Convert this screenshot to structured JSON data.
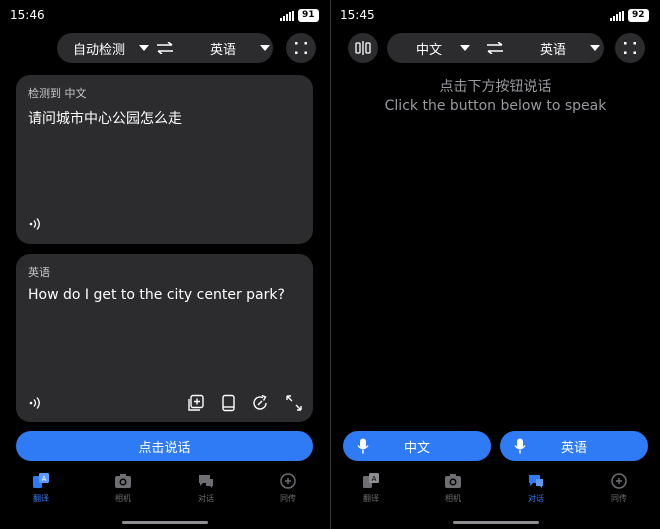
{
  "left": {
    "status": {
      "time": "15:46",
      "battery": "91"
    },
    "lang_bar": {
      "source": "自动检测",
      "target": "英语"
    },
    "source_card": {
      "label": "检测到 中文",
      "text": "请问城市中心公园怎么走"
    },
    "target_card": {
      "label": "英语",
      "text": "How do I get to the city center park?"
    },
    "speak_button": "点击说话"
  },
  "right": {
    "status": {
      "time": "15:45",
      "battery": "92"
    },
    "lang_bar": {
      "source": "中文",
      "target": "英语"
    },
    "hint_cn": "点击下方按钮说话",
    "hint_en": "Click the button below to speak",
    "mic_buttons": [
      "中文",
      "英语"
    ]
  },
  "nav": [
    {
      "label": "翻译",
      "icon": "translate-icon"
    },
    {
      "label": "相机",
      "icon": "camera-icon"
    },
    {
      "label": "对话",
      "icon": "chat-icon"
    },
    {
      "label": "同传",
      "icon": "simultaneous-icon"
    }
  ],
  "left_active_nav": "翻译",
  "right_active_nav": "对话",
  "colors": {
    "accent": "#2f7bf5",
    "card": "#2c2c2e",
    "background": "#000000"
  }
}
